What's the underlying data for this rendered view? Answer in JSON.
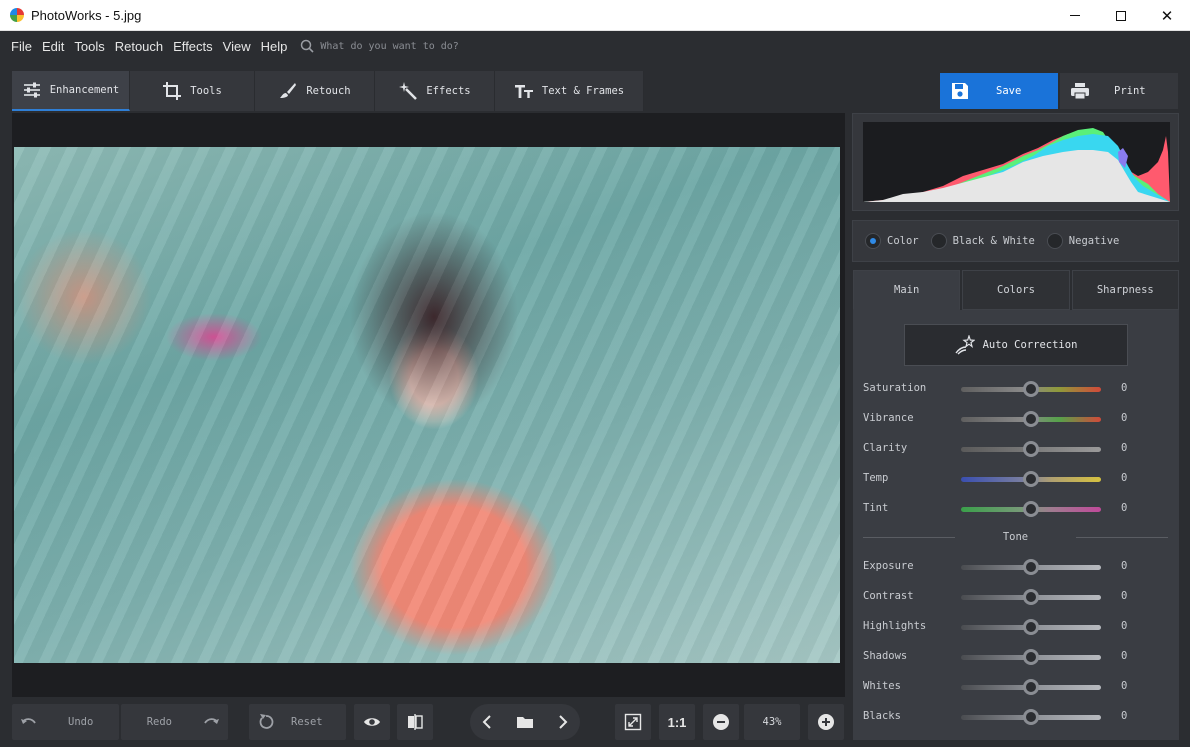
{
  "window": {
    "title": "PhotoWorks - 5.jpg"
  },
  "menu": {
    "items": [
      "File",
      "Edit",
      "Tools",
      "Retouch",
      "Effects",
      "View",
      "Help"
    ],
    "search_placeholder": "What do you want to do?"
  },
  "tabs": [
    {
      "label": "Enhancement",
      "active": true
    },
    {
      "label": "Tools"
    },
    {
      "label": "Retouch"
    },
    {
      "label": "Effects"
    },
    {
      "label": "Text & Frames"
    }
  ],
  "actions": {
    "save_label": "Save",
    "print_label": "Print"
  },
  "color_modes": [
    {
      "label": "Color",
      "selected": true
    },
    {
      "label": "Black & White"
    },
    {
      "label": "Negative"
    }
  ],
  "subtabs": [
    {
      "label": "Main",
      "active": true
    },
    {
      "label": "Colors"
    },
    {
      "label": "Sharpness"
    }
  ],
  "auto_correction_label": "Auto Correction",
  "sliders": [
    {
      "label": "Saturation",
      "value": "0",
      "track": "linear-gradient(90deg,#5f5f5f,#8a8a8a 45%,#8f9a3a 70%,#d24a3a)"
    },
    {
      "label": "Vibrance",
      "value": "0",
      "track": "linear-gradient(90deg,#5f5f5f,#8a8a8a 45%,#56a24a 70%,#d24a3a)"
    },
    {
      "label": "Clarity",
      "value": "0",
      "track": "linear-gradient(90deg,#5a5a5a,#9a9a9a)"
    },
    {
      "label": "Temp",
      "value": "0",
      "track": "linear-gradient(90deg,#3a4fb0,#7a7fa0 45%,#b0a070 65%,#d6c240)"
    },
    {
      "label": "Tint",
      "value": "0",
      "track": "linear-gradient(90deg,#3aa04a,#7a9a7a 45%,#a07a90 65%,#c04a9a)"
    }
  ],
  "tone_label": "Tone",
  "tone_sliders": [
    {
      "label": "Exposure",
      "value": "0"
    },
    {
      "label": "Contrast",
      "value": "0"
    },
    {
      "label": "Highlights",
      "value": "0"
    },
    {
      "label": "Shadows",
      "value": "0"
    },
    {
      "label": "Whites",
      "value": "0"
    },
    {
      "label": "Blacks",
      "value": "0"
    }
  ],
  "bottom": {
    "undo_label": "Undo",
    "redo_label": "Redo",
    "reset_label": "Reset",
    "one_to_one_label": "1:1",
    "zoom_value": "43%"
  },
  "colors": {
    "accent": "#1a73d9",
    "panel": "#35373c",
    "background": "#2b2d31"
  }
}
